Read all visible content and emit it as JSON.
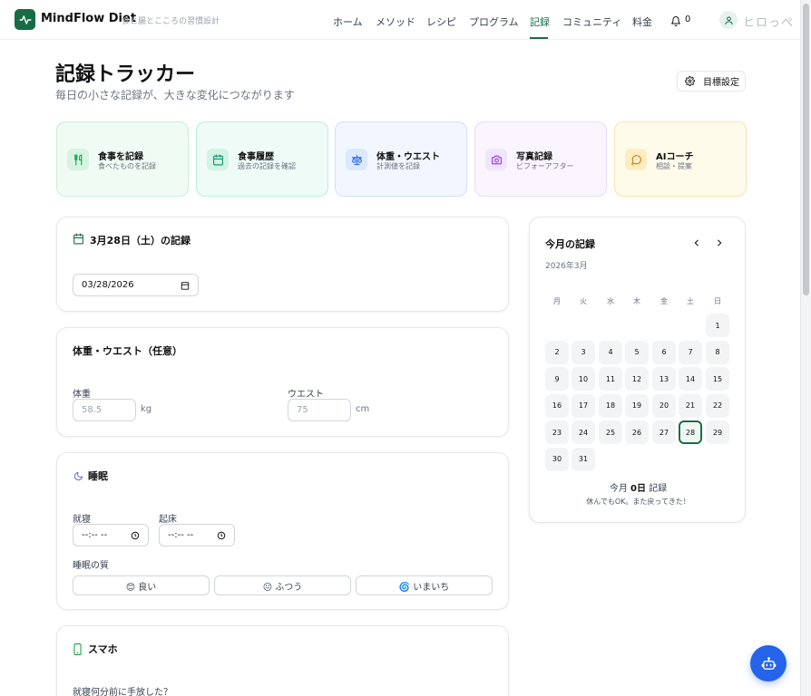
{
  "nav": {
    "brand": "MindFlow Diet",
    "tagline": "食と腸とこころの習慣設計",
    "links": [
      "ホーム",
      "メソッド",
      "レシピ",
      "プログラム",
      "記録",
      "コミュニティ",
      "料金"
    ],
    "active_link": "記録",
    "notification_count": "0",
    "user_name": "ヒロっぺ"
  },
  "header": {
    "title": "記録トラッカー",
    "subtitle": "毎日の小さな記録が、大きな変化につながります",
    "goal_button": "目標設定"
  },
  "quick_cards": [
    {
      "title": "食事を記録",
      "subtitle": "食べたものを記録",
      "icon": "utensils-icon",
      "color": "#16a34a"
    },
    {
      "title": "食事履歴",
      "subtitle": "過去の記録を確認",
      "icon": "calendar-icon",
      "color": "#059669"
    },
    {
      "title": "体重・ウエスト",
      "subtitle": "計測値を記録",
      "icon": "scale-icon",
      "color": "#2563eb"
    },
    {
      "title": "写真記録",
      "subtitle": "ビフォーアフター",
      "icon": "camera-icon",
      "color": "#9333ea"
    },
    {
      "title": "AIコーチ",
      "subtitle": "相談・提案",
      "icon": "chat-icon",
      "color": "#d97706"
    }
  ],
  "date_section": {
    "title": "3月28日（土）の記録",
    "date_value": "03/28/2026"
  },
  "body_section": {
    "title": "体重・ウエスト（任意）",
    "weight_label": "体重",
    "weight_placeholder": "58.5",
    "weight_unit": "kg",
    "waist_label": "ウエスト",
    "waist_placeholder": "75",
    "waist_unit": "cm"
  },
  "sleep_section": {
    "title": "睡眠",
    "bedtime_label": "就寝",
    "wake_label": "起床",
    "time_placeholder": "--:-- --",
    "quality_label": "睡眠の質",
    "quality_options": [
      "😊 良い",
      "😐 ふつう",
      "🌀 いまいち"
    ]
  },
  "phone_section": {
    "title": "スマホ",
    "question": "就寝何分前に手放した？"
  },
  "calendar": {
    "title": "今月の記録",
    "month": "2026年3月",
    "weekdays": [
      "月",
      "火",
      "水",
      "木",
      "金",
      "土",
      "日"
    ],
    "days": [
      "1",
      "2",
      "3",
      "4",
      "5",
      "6",
      "7",
      "8",
      "9",
      "10",
      "11",
      "12",
      "13",
      "14",
      "15",
      "16",
      "17",
      "18",
      "19",
      "20",
      "21",
      "22",
      "23",
      "24",
      "25",
      "26",
      "27",
      "28",
      "29",
      "30",
      "31"
    ],
    "today": "28",
    "count_prefix": "今月",
    "count_value": "0日",
    "count_suffix": "記録",
    "message": "休んでもOK。また戻ってきた！"
  }
}
